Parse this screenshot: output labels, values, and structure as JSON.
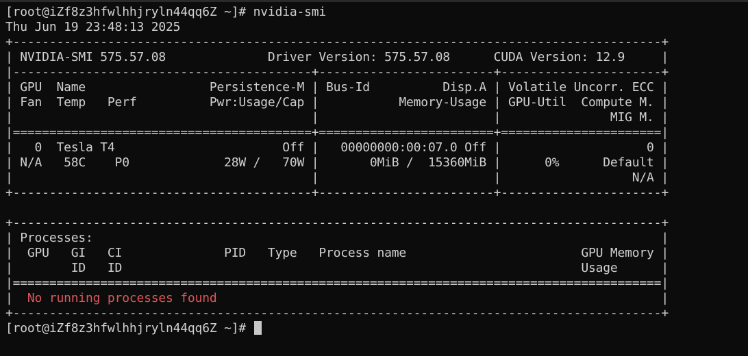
{
  "terminal": {
    "prompt": "[root@iZf8z3hfwlhhjryln44qq6Z ~]# ",
    "command": "nvidia-smi",
    "timestamp": "Thu Jun 19 23:48:13 2025",
    "smi_lines": [
      "+-----------------------------------------------------------------------------------------+",
      "| NVIDIA-SMI 575.57.08              Driver Version: 575.57.08      CUDA Version: 12.9     |",
      "|-----------------------------------------+------------------------+----------------------+",
      "| GPU  Name                 Persistence-M | Bus-Id          Disp.A | Volatile Uncorr. ECC |",
      "| Fan  Temp   Perf          Pwr:Usage/Cap |           Memory-Usage | GPU-Util  Compute M. |",
      "|                                         |                        |               MIG M. |",
      "|=========================================+========================+======================|",
      "|   0  Tesla T4                       Off |   00000000:00:07.0 Off |                    0 |",
      "| N/A   58C    P0             28W /   70W |       0MiB /  15360MiB |      0%      Default |",
      "|                                         |                        |                  N/A |",
      "+-----------------------------------------+------------------------+----------------------+",
      "",
      "+-----------------------------------------------------------------------------------------+",
      "| Processes:                                                                              |",
      "|  GPU   GI   CI              PID   Type   Process name                        GPU Memory |",
      "|        ID   ID                                                               Usage      |",
      "|=========================================================================================|"
    ],
    "no_process_prefix": "|  ",
    "no_process_message": "No running processes found",
    "no_process_suffix": "                                                             |",
    "bottom_border": "+-----------------------------------------------------------------------------------------+"
  }
}
